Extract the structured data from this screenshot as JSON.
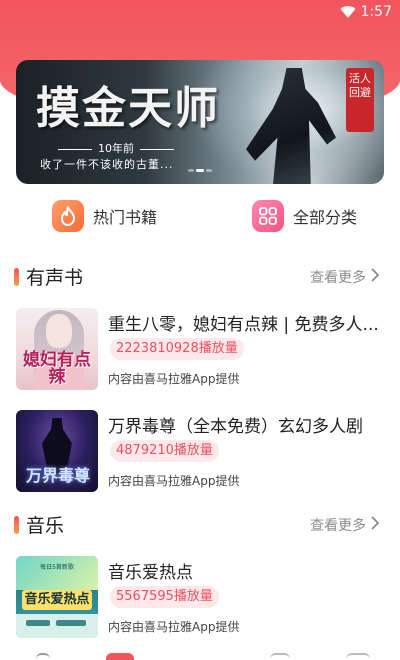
{
  "status_bar": {
    "time": "1:57",
    "wifi_icon": "wifi-icon"
  },
  "banner": {
    "title": "摸金天师",
    "line1": "10年前",
    "line2": "收了一件不该收的古董...",
    "seal": "活人回避",
    "dots": 3,
    "active_dot": 2
  },
  "quick_links": [
    {
      "label": "热门书籍",
      "icon": "fire-icon",
      "color": "#f46a3a"
    },
    {
      "label": "全部分类",
      "icon": "grid-icon",
      "color": "#f2557f"
    }
  ],
  "sections": {
    "audiobooks": {
      "title": "有声书",
      "more": "查看更多",
      "items": [
        {
          "name": "重生八零，媳妇有点辣 | 免费多人...",
          "plays": "2223810928播放量",
          "source": "内容由喜马拉雅App提供",
          "cover_text": "媳妇有点辣"
        },
        {
          "name": "万界毒尊（全本免费）玄幻多人剧",
          "plays": "4879210播放量",
          "source": "内容由喜马拉雅App提供",
          "cover_text": "万界毒尊"
        }
      ]
    },
    "music": {
      "title": "音乐",
      "more": "查看更多",
      "items": [
        {
          "name": "音乐爱热点",
          "plays": "5567595播放量",
          "source": "内容由喜马拉雅App提供",
          "cover_text": "音乐爱热点",
          "cover_small": "每日5首新歌"
        }
      ]
    }
  },
  "colors": {
    "accent": "#f2545d",
    "badge_bg": "#fde8ea",
    "badge_text": "#f0505f"
  }
}
